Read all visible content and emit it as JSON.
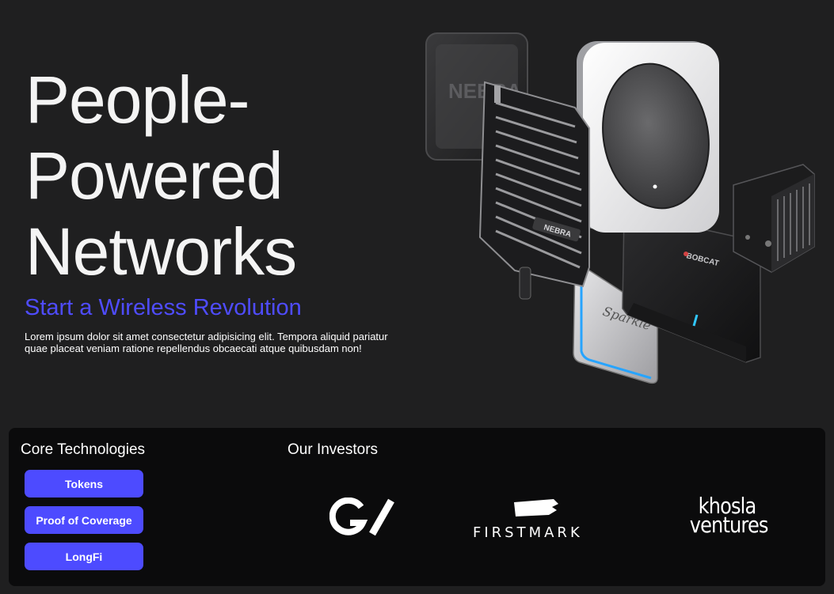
{
  "hero": {
    "title_line1": "People-",
    "title_line2": "Powered",
    "title_line3": "Networks",
    "subtitle": "Start a Wireless Revolution",
    "blurb": "Lorem ipsum dolor sit amet consectetur adipisicing elit. Tempora aliquid pariatur quae placeat veniam ratione repellendus obcaecati atque quibusdam non!",
    "device_labels": {
      "nebra_back": "NEBRA",
      "nebra_front": "NEBRA",
      "bobcat": "BOBCAT",
      "script": "Sparkle"
    }
  },
  "core": {
    "heading": "Core Technologies",
    "buttons": [
      "Tokens",
      "Proof of Coverage",
      "LongFi"
    ]
  },
  "investors": {
    "heading": "Our Investors",
    "logos": {
      "gv": "GV",
      "firstmark": "FIRSTMARK",
      "khosla_line1": "khosla",
      "khosla_line2": "ventures"
    }
  },
  "colors": {
    "accent": "#4d4bff",
    "background": "#1f1f20",
    "panel": "#0b0b0c"
  }
}
